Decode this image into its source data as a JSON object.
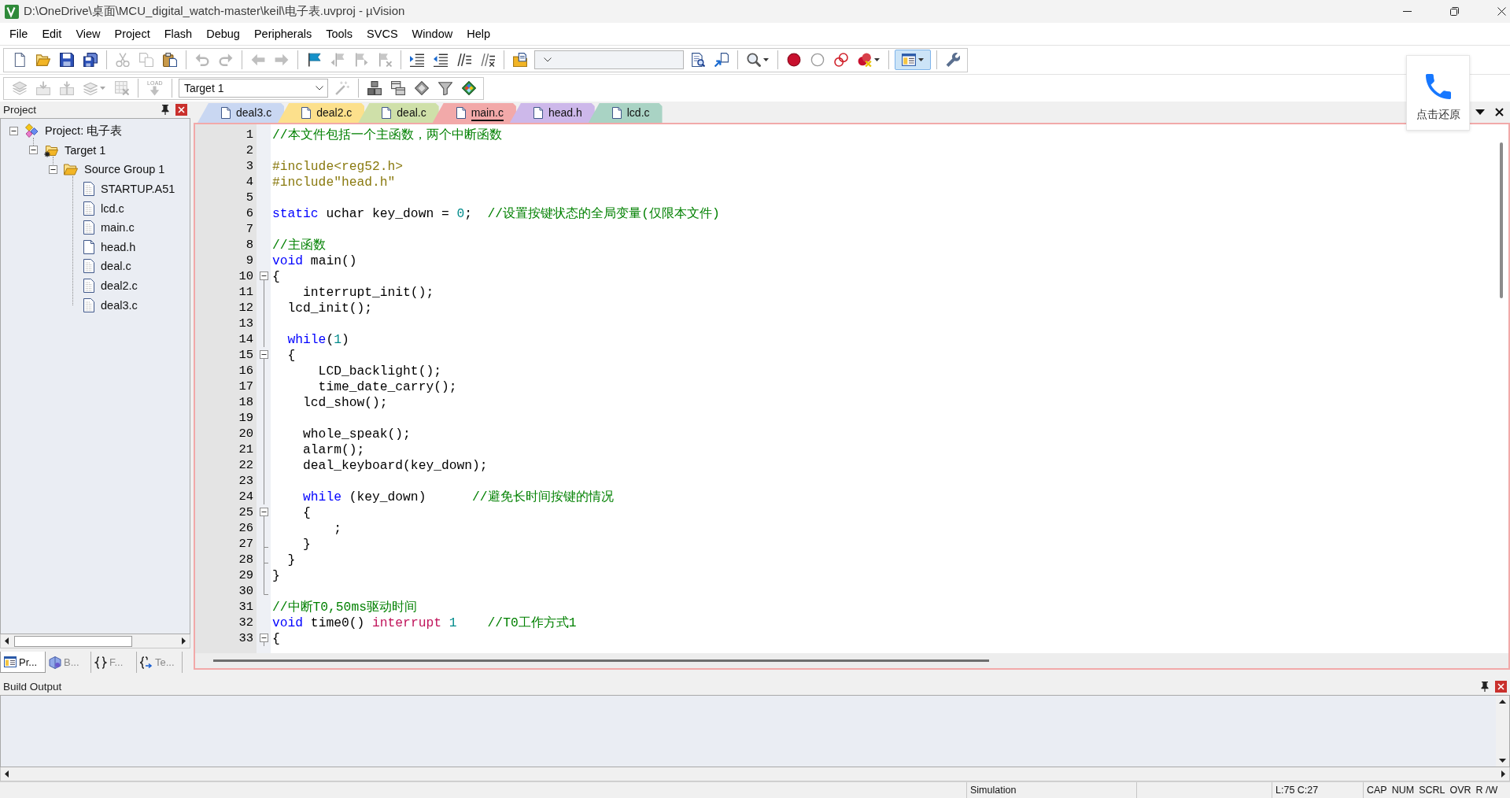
{
  "window": {
    "title": "D:\\OneDrive\\桌面\\MCU_digital_watch-master\\keil\\电子表.uvproj - µVision"
  },
  "menu": [
    "File",
    "Edit",
    "View",
    "Project",
    "Flash",
    "Debug",
    "Peripherals",
    "Tools",
    "SVCS",
    "Window",
    "Help"
  ],
  "toolbar_1": [
    {
      "kind": "new",
      "disabled": false,
      "pressed": false
    },
    {
      "kind": "open",
      "disabled": false,
      "pressed": false
    },
    {
      "kind": "save",
      "disabled": false,
      "pressed": false
    },
    {
      "kind": "saveall",
      "disabled": false,
      "pressed": false
    },
    {
      "kind": "separator"
    },
    {
      "kind": "cut",
      "disabled": true,
      "pressed": false
    },
    {
      "kind": "copy",
      "disabled": true,
      "pressed": false
    },
    {
      "kind": "paste",
      "disabled": false,
      "pressed": false
    },
    {
      "kind": "separator"
    },
    {
      "kind": "undo",
      "disabled": true,
      "pressed": false
    },
    {
      "kind": "redo",
      "disabled": true,
      "pressed": false
    },
    {
      "kind": "separator"
    },
    {
      "kind": "back",
      "disabled": true,
      "pressed": false
    },
    {
      "kind": "forward",
      "disabled": true,
      "pressed": false
    },
    {
      "kind": "separator"
    },
    {
      "kind": "bookmark",
      "disabled": false,
      "pressed": false
    },
    {
      "kind": "prevmark",
      "disabled": true,
      "pressed": false
    },
    {
      "kind": "nextmark",
      "disabled": true,
      "pressed": false
    },
    {
      "kind": "clearmarks",
      "disabled": true,
      "pressed": false
    },
    {
      "kind": "separator"
    },
    {
      "kind": "indent",
      "disabled": false,
      "pressed": false
    },
    {
      "kind": "outdent",
      "disabled": false,
      "pressed": false
    },
    {
      "kind": "comment",
      "disabled": false,
      "pressed": false
    },
    {
      "kind": "uncomment",
      "disabled": false,
      "pressed": false
    },
    {
      "kind": "separator"
    },
    {
      "kind": "findfiles",
      "disabled": false,
      "pressed": false
    },
    {
      "kind": "combo"
    },
    {
      "kind": "find",
      "disabled": false,
      "pressed": false
    },
    {
      "kind": "debugfind",
      "disabled": false,
      "pressed": false
    },
    {
      "kind": "separator"
    },
    {
      "kind": "search",
      "disabled": false,
      "pressed": false,
      "dropdown": true
    },
    {
      "kind": "separator"
    },
    {
      "kind": "breakpoint",
      "disabled": false,
      "pressed": false
    },
    {
      "kind": "bpdisabled",
      "disabled": false,
      "pressed": false
    },
    {
      "kind": "bpall",
      "disabled": false,
      "pressed": false
    },
    {
      "kind": "bpkill",
      "disabled": false,
      "pressed": false,
      "dropdown": true
    },
    {
      "kind": "separator"
    },
    {
      "kind": "layout",
      "disabled": false,
      "pressed": true,
      "dropdown": true
    },
    {
      "kind": "separator"
    },
    {
      "kind": "config",
      "disabled": false,
      "pressed": false
    }
  ],
  "toolbar_2": [
    {
      "kind": "translate",
      "disabled": true,
      "pressed": false
    },
    {
      "kind": "build",
      "disabled": true,
      "pressed": false
    },
    {
      "kind": "rebuild",
      "disabled": true,
      "pressed": false
    },
    {
      "kind": "batch",
      "disabled": true,
      "pressed": false,
      "dropdown": true
    },
    {
      "kind": "stop",
      "disabled": true,
      "pressed": false
    },
    {
      "kind": "separator"
    },
    {
      "kind": "download",
      "label": "LOAD",
      "disabled": true,
      "pressed": false
    },
    {
      "kind": "separator"
    },
    {
      "kind": "combo",
      "value": "Target 1"
    },
    {
      "kind": "wand",
      "disabled": true,
      "pressed": false
    },
    {
      "kind": "separator"
    },
    {
      "kind": "components",
      "disabled": false,
      "pressed": false
    },
    {
      "kind": "windows",
      "disabled": false,
      "pressed": false
    },
    {
      "kind": "diamond",
      "disabled": false,
      "pressed": false
    },
    {
      "kind": "funnel",
      "disabled": false,
      "pressed": false
    },
    {
      "kind": "packs",
      "disabled": false,
      "pressed": false
    }
  ],
  "project_panel": {
    "title": "Project",
    "tree": [
      {
        "label": "Project: 电子表",
        "kind": "project",
        "expanded": true,
        "children": [
          {
            "label": "Target 1",
            "kind": "target",
            "expanded": true,
            "children": [
              {
                "label": "Source Group 1",
                "kind": "group",
                "expanded": true,
                "children": [
                  {
                    "label": "STARTUP.A51",
                    "kind": "source"
                  },
                  {
                    "label": "lcd.c",
                    "kind": "source"
                  },
                  {
                    "label": "main.c",
                    "kind": "source"
                  },
                  {
                    "label": "head.h",
                    "kind": "header"
                  },
                  {
                    "label": "deal.c",
                    "kind": "source"
                  },
                  {
                    "label": "deal2.c",
                    "kind": "source"
                  },
                  {
                    "label": "deal3.c",
                    "kind": "source"
                  }
                ]
              }
            ]
          }
        ]
      }
    ],
    "tabs": [
      {
        "label": "Pr...",
        "kind": "project",
        "selected": true
      },
      {
        "label": "B...",
        "kind": "books",
        "selected": false
      },
      {
        "label": "F...",
        "kind": "functions",
        "selected": false
      },
      {
        "label": "Te...",
        "kind": "templates",
        "selected": false
      }
    ]
  },
  "editor_tabs": [
    {
      "label": "deal3.c",
      "color": "#c9d7f2",
      "selected": false
    },
    {
      "label": "deal2.c",
      "color": "#fce08c",
      "selected": false
    },
    {
      "label": "deal.c",
      "color": "#cfe0a9",
      "selected": false
    },
    {
      "label": "main.c",
      "color": "#f2a9a9",
      "selected": true
    },
    {
      "label": "head.h",
      "color": "#cdb8ea",
      "selected": false
    },
    {
      "label": "lcd.c",
      "color": "#a9d3c4",
      "selected": false
    }
  ],
  "code_lines": [
    {
      "number": "1",
      "kind": "plain",
      "tokens": [
        {
          "kind": "comment",
          "text": "//本文件包括一个主函数，两个中断函数"
        }
      ]
    },
    {
      "number": "2",
      "kind": "plain"
    },
    {
      "number": "3",
      "kind": "plain",
      "tokens": [
        {
          "kind": "preprocessor",
          "text": "#include<reg52.h>"
        }
      ]
    },
    {
      "number": "4",
      "kind": "plain",
      "tokens": [
        {
          "kind": "preprocessor",
          "text": "#include\"head.h\""
        }
      ]
    },
    {
      "number": "5",
      "kind": "plain"
    },
    {
      "number": "6",
      "kind": "plain",
      "tokens": [
        {
          "kind": "keyword",
          "text": "static"
        },
        {
          "kind": "text",
          "text": " uchar key_down = "
        },
        {
          "kind": "number",
          "text": "0"
        },
        {
          "kind": "text",
          "text": ";"
        },
        {
          "kind": "comment",
          "text": "  //设置按键状态的全局变量(仅限本文件)"
        }
      ]
    },
    {
      "number": "7",
      "kind": "plain"
    },
    {
      "number": "8",
      "kind": "plain",
      "tokens": [
        {
          "kind": "comment",
          "text": "//主函数"
        }
      ]
    },
    {
      "number": "9",
      "kind": "plain",
      "tokens": [
        {
          "kind": "keyword",
          "text": "void"
        },
        {
          "kind": "text",
          "text": " main()"
        }
      ]
    },
    {
      "number": "10",
      "kind": "open",
      "tokens": [
        {
          "kind": "text",
          "text": "{"
        }
      ]
    },
    {
      "number": "11",
      "kind": "guide",
      "tokens": [
        {
          "kind": "text",
          "text": "    interrupt_init();"
        }
      ]
    },
    {
      "number": "12",
      "kind": "guide",
      "tokens": [
        {
          "kind": "text",
          "text": "  lcd_init();"
        }
      ]
    },
    {
      "number": "13",
      "kind": "guide"
    },
    {
      "number": "14",
      "kind": "guide",
      "tokens": [
        {
          "kind": "keyword",
          "text": "  while"
        },
        {
          "kind": "text",
          "text": "("
        },
        {
          "kind": "number",
          "text": "1"
        },
        {
          "kind": "text",
          "text": ")"
        }
      ]
    },
    {
      "number": "15",
      "kind": "open",
      "tokens": [
        {
          "kind": "text",
          "text": "  {"
        }
      ]
    },
    {
      "number": "16",
      "kind": "guide",
      "tokens": [
        {
          "kind": "text",
          "text": "      LCD_backlight();"
        }
      ]
    },
    {
      "number": "17",
      "kind": "guide",
      "tokens": [
        {
          "kind": "text",
          "text": "      time_date_carry();"
        }
      ]
    },
    {
      "number": "18",
      "kind": "guide",
      "tokens": [
        {
          "kind": "text",
          "text": "    lcd_show();"
        }
      ]
    },
    {
      "number": "19",
      "kind": "guide"
    },
    {
      "number": "20",
      "kind": "guide",
      "tokens": [
        {
          "kind": "text",
          "text": "    whole_speak();"
        }
      ]
    },
    {
      "number": "21",
      "kind": "guide",
      "tokens": [
        {
          "kind": "text",
          "text": "    alarm();"
        }
      ]
    },
    {
      "number": "22",
      "kind": "guide",
      "tokens": [
        {
          "kind": "text",
          "text": "    deal_keyboard(key_down);"
        }
      ]
    },
    {
      "number": "23",
      "kind": "guide"
    },
    {
      "number": "24",
      "kind": "guide",
      "tokens": [
        {
          "kind": "keyword",
          "text": "    while"
        },
        {
          "kind": "text",
          "text": " (key_down)"
        },
        {
          "kind": "comment",
          "text": "      //避免长时间按键的情况"
        }
      ]
    },
    {
      "number": "25",
      "kind": "open",
      "tokens": [
        {
          "kind": "text",
          "text": "    {"
        }
      ]
    },
    {
      "number": "26",
      "kind": "guide",
      "tokens": [
        {
          "kind": "text",
          "text": "        ;"
        }
      ]
    },
    {
      "number": "27",
      "kind": "branch",
      "tokens": [
        {
          "kind": "text",
          "text": "    }"
        }
      ]
    },
    {
      "number": "28",
      "kind": "branch",
      "tokens": [
        {
          "kind": "text",
          "text": "  }"
        }
      ]
    },
    {
      "number": "29",
      "kind": "guide",
      "tokens": [
        {
          "kind": "text",
          "text": "}"
        }
      ]
    },
    {
      "number": "30",
      "kind": "last"
    },
    {
      "number": "31",
      "kind": "plain",
      "tokens": [
        {
          "kind": "comment",
          "text": "//中断T0,50ms驱动时间"
        }
      ]
    },
    {
      "number": "32",
      "kind": "plain",
      "tokens": [
        {
          "kind": "keyword",
          "text": "void"
        },
        {
          "kind": "text",
          "text": " time0() "
        },
        {
          "kind": "keyword2",
          "text": "interrupt"
        },
        {
          "kind": "number",
          "text": " 1"
        },
        {
          "kind": "comment",
          "text": "    //T0工作方式1"
        }
      ]
    },
    {
      "number": "33",
      "kind": "open",
      "tokens": [
        {
          "kind": "text",
          "text": "{"
        }
      ]
    }
  ],
  "build_output": {
    "title": "Build Output"
  },
  "status_bar": {
    "mode": "Simulation",
    "position": "L:75 C:27",
    "indicators": [
      "CAP",
      "NUM",
      "SCRL",
      "OVR",
      "R /W"
    ]
  },
  "floating_widget": {
    "label": "点击还原"
  }
}
